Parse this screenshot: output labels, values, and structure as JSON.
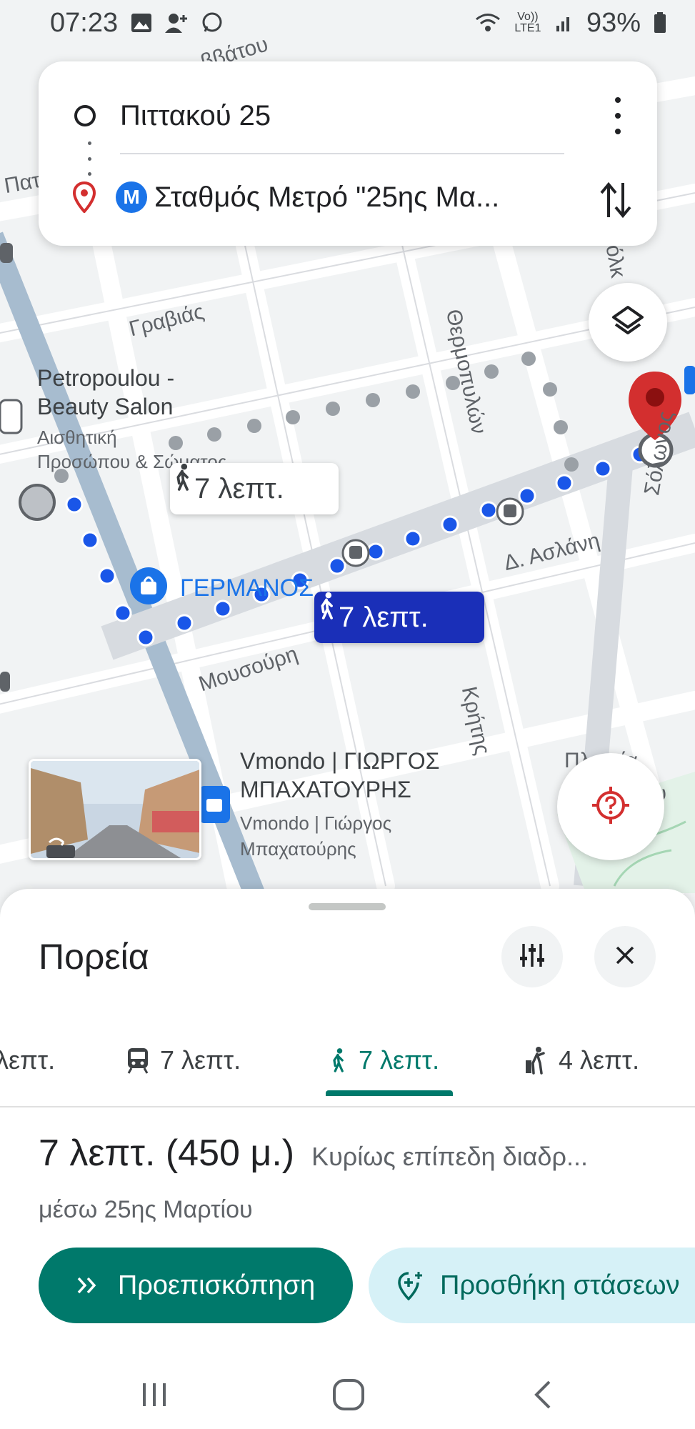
{
  "status_bar": {
    "time": "07:23",
    "network": "Vo)) LTE1",
    "battery": "93%"
  },
  "search": {
    "origin": "Πιττακού 25",
    "destination": "Σταθμός Μετρό \"25ης Μα...",
    "metro_badge": "M"
  },
  "map": {
    "streets": [
      "Γραβιάς",
      "Θερμοπυλών",
      "Δ. Ασλάνη",
      "Μουσούρη",
      "Κρήτης",
      "Σόλωνος",
      "Πατ",
      "Πλατεία",
      "ου",
      "όλκ",
      "ββάτου"
    ],
    "pois": {
      "salon_name": "Petropoulou - Beauty Salon",
      "salon_line1": "Petropoulou -",
      "salon_line2": "Beauty Salon",
      "salon_sub1": "Αισθητική",
      "salon_sub2": "Προσώπου & Σώματος",
      "germanos": "ΓΕΡΜΑΝΟΣ",
      "vmondo_line1": "Vmondo | ΓΙΩΡΓΟΣ",
      "vmondo_line2": "ΜΠΑΧΑΤΟΥΡΗΣ",
      "vmondo_sub1": "Vmondo | Γιώργος",
      "vmondo_sub2": "Μπαχατούρης"
    },
    "callout_alt": "7 λεπτ.",
    "callout_main": "7 λεπτ."
  },
  "sheet": {
    "title": "Πορεία",
    "tabs": [
      {
        "label": "λεπτ.",
        "mode": "car"
      },
      {
        "label": "7 λεπτ.",
        "mode": "transit"
      },
      {
        "label": "7 λεπτ.",
        "mode": "walk",
        "active": true
      },
      {
        "label": "4 λεπτ.",
        "mode": "ride"
      }
    ],
    "route_time": "7 λεπτ. (450 μ.)",
    "route_desc": "Κυρίως επίπεδη διαδρ...",
    "route_via": "μέσω 25ης Μαρτίου",
    "preview_label": "Προεπισκόπηση",
    "add_stops_label": "Προσθήκη στάσεων"
  },
  "colors": {
    "route_blue": "#1a56e8",
    "route_alt": "#9aa0a6",
    "accent_teal": "#00796b",
    "pin_red": "#d32f2f"
  }
}
